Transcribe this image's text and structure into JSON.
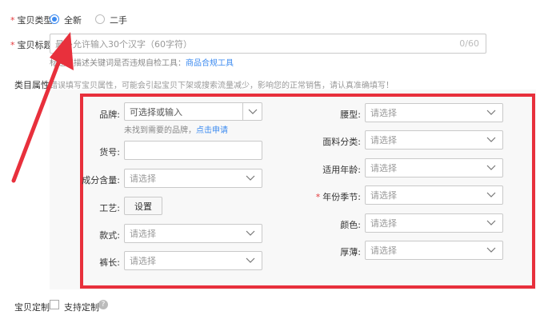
{
  "item_type": {
    "label": "宝贝类型",
    "options": [
      "全新",
      "二手"
    ],
    "selected": 0
  },
  "item_title": {
    "label": "宝贝标题",
    "placeholder": "最多允许输入30个汉字（60字符）",
    "counter": "0/60",
    "hint_prefix": "标题和描述关键词是否违规自检工具：",
    "hint_link": "商品合规工具"
  },
  "category_attrs": {
    "label": "类目属性",
    "notice": "错误填写宝贝属性，可能会引起宝贝下架或搜索流量减少，影响您的正常销售，请认真准确填写！"
  },
  "left_fields": {
    "brand": {
      "label": "品牌:",
      "placeholder": "可选择或输入",
      "hint": "未找到需要的品牌，",
      "hint_link": "点击申请"
    },
    "model": {
      "label": "货号:"
    },
    "composition": {
      "label": "成分含量:",
      "placeholder": "请选择"
    },
    "craft": {
      "label": "工艺:",
      "button": "设置"
    },
    "style": {
      "label": "款式:",
      "placeholder": "请选择"
    },
    "length": {
      "label": "裤长:",
      "placeholder": "请选择"
    }
  },
  "right_fields": {
    "waist": {
      "label": "腰型:",
      "placeholder": "请选择"
    },
    "fabric": {
      "label": "面料分类:",
      "placeholder": "请选择"
    },
    "age": {
      "label": "适用年龄:",
      "placeholder": "请选择"
    },
    "season": {
      "label": "年份季节:",
      "placeholder": "请选择",
      "required": true
    },
    "color": {
      "label": "颜色:",
      "placeholder": "请选择"
    },
    "thickness": {
      "label": "厚薄:",
      "placeholder": "请选择"
    }
  },
  "customize": {
    "label": "宝贝定制",
    "checkbox_label": "支持定制"
  },
  "colors": {
    "annotation_red": "#e8303c",
    "accent_blue": "#3d8bf0"
  },
  "icons": {
    "dropdown": "chevron-down-icon",
    "help": "question-circle-icon",
    "arrow": "annotation-arrow-icon"
  }
}
